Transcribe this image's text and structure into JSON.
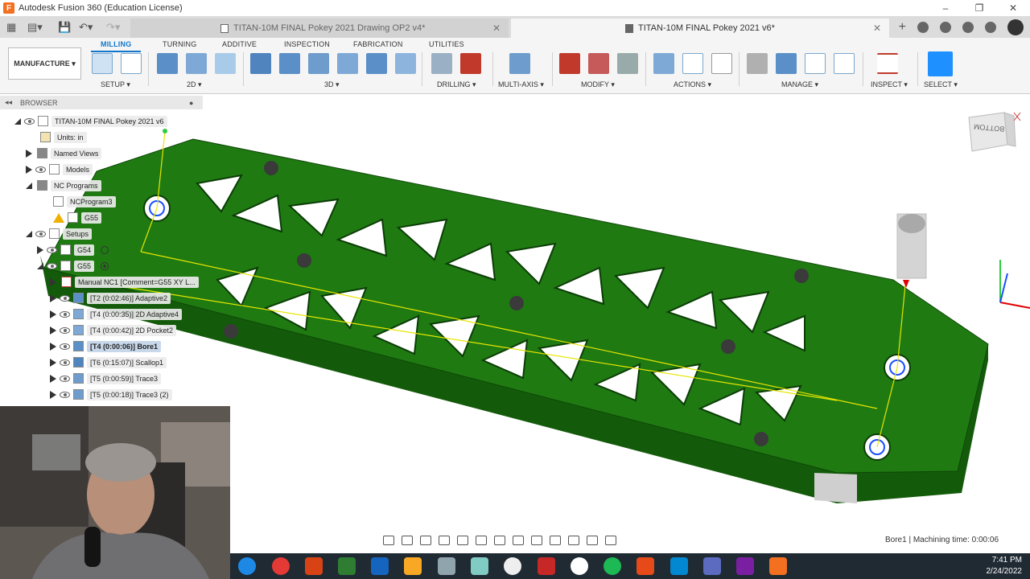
{
  "window": {
    "title": "Autodesk Fusion 360 (Education License)",
    "logo_letter": "F"
  },
  "tabs": [
    {
      "label": "TITAN-10M FINAL Pokey 2021 Drawing OP2 v4*",
      "active": false
    },
    {
      "label": "TITAN-10M FINAL Pokey 2021 v6*",
      "active": true
    }
  ],
  "ribbon": {
    "workspace": "MANUFACTURE",
    "tabs": [
      "MILLING",
      "TURNING",
      "ADDITIVE",
      "INSPECTION",
      "FABRICATION",
      "UTILITIES"
    ],
    "selected_tab": "MILLING",
    "groups": [
      "SETUP",
      "2D",
      "3D",
      "DRILLING",
      "MULTI-AXIS",
      "MODIFY",
      "ACTIONS",
      "MANAGE",
      "INSPECT",
      "SELECT"
    ],
    "accent": "#1177cc"
  },
  "browser": {
    "title": "BROWSER",
    "nodes": [
      {
        "label": "TITAN-10M FINAL Pokey 2021 v6"
      },
      {
        "label": "Units: in"
      },
      {
        "label": "Named Views"
      },
      {
        "label": "Models"
      },
      {
        "label": "NC Programs"
      },
      {
        "label": "NCProgram3"
      },
      {
        "label": "G55"
      },
      {
        "label": "Setups"
      },
      {
        "label": "G54"
      },
      {
        "label": "G55"
      },
      {
        "label": "Manual NC1 [Comment=G55 XY L..."
      },
      {
        "label": "[T2 (0:02:46)] Adaptive2"
      },
      {
        "label": "[T4 (0:00:35)] 2D Adaptive4"
      },
      {
        "label": "[T4 (0:00:42)] 2D Pocket2"
      },
      {
        "label": "[T4 (0:00:06)] Bore1",
        "selected": true
      },
      {
        "label": "[T6 (0:15:07)] Scallop1"
      },
      {
        "label": "[T5 (0:00:59)] Trace3"
      },
      {
        "label": "[T5 (0:00:18)] Trace3 (2)"
      }
    ]
  },
  "viewcube": {
    "face_label": "BOTTOM"
  },
  "status": {
    "text": "Bore1 | Machining time: 0:00:06"
  },
  "taskbar": {
    "time": "7:41 PM",
    "date": "2/24/2022"
  },
  "colors": {
    "part_green": "#1f7a12",
    "part_dark": "#135b0a",
    "toolpath": "#e6e600"
  }
}
